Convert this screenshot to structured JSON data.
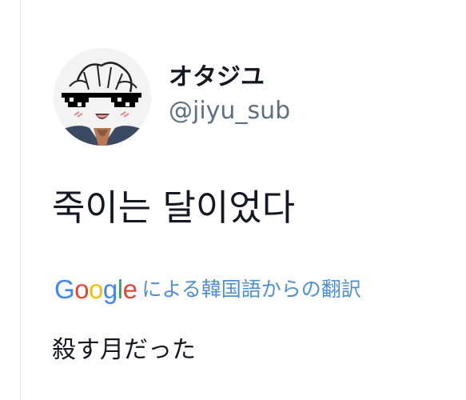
{
  "user": {
    "display_name": "オタジユ",
    "handle": "@jiyu_sub"
  },
  "tweet": {
    "text": "죽이는 달이었다"
  },
  "translation": {
    "provider_letters": [
      "G",
      "o",
      "o",
      "g",
      "l",
      "e"
    ],
    "provider_colors": [
      "#4285F4",
      "#EA4335",
      "#FBBC05",
      "#4285F4",
      "#34A853",
      "#EA4335"
    ],
    "label": "による韓国語からの翻訳",
    "label_color": "#4f8fd1",
    "text": "殺す月だった"
  },
  "colors": {
    "name": "#141823",
    "handle": "#5b7083"
  }
}
